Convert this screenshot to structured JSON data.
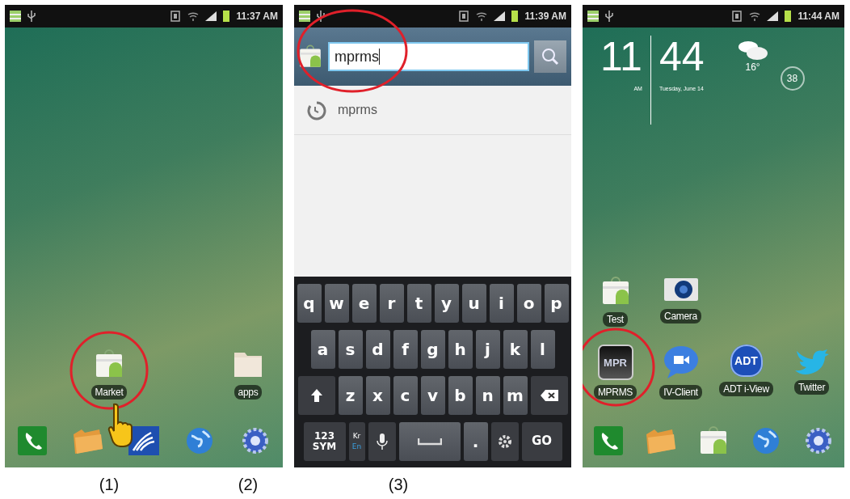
{
  "screens": [
    {
      "kind": "home",
      "status_bar": {
        "time": "11:37 AM"
      },
      "icon_rows": [
        [
          {
            "kind": "empty"
          },
          {
            "kind": "market",
            "label": "Market",
            "circled": true,
            "touched": true
          },
          {
            "kind": "empty"
          },
          {
            "kind": "folder",
            "label": "apps"
          }
        ]
      ],
      "dock": [
        {
          "kind": "phone"
        },
        {
          "kind": "files"
        },
        {
          "kind": "waves"
        },
        {
          "kind": "globe"
        },
        {
          "kind": "gear"
        }
      ]
    },
    {
      "kind": "search",
      "status_bar": {
        "time": "11:39 AM"
      },
      "search": {
        "value": "mprms",
        "circled": true
      },
      "suggestions": [
        {
          "text": "mprms"
        }
      ],
      "keyboard": [
        [
          {
            "kind": "char",
            "label": "q"
          },
          {
            "kind": "char",
            "label": "w"
          },
          {
            "kind": "char",
            "label": "e"
          },
          {
            "kind": "char",
            "label": "r"
          },
          {
            "kind": "char",
            "label": "t"
          },
          {
            "kind": "char",
            "label": "y"
          },
          {
            "kind": "char",
            "label": "u"
          },
          {
            "kind": "char",
            "label": "i"
          },
          {
            "kind": "char",
            "label": "o"
          },
          {
            "kind": "char",
            "label": "p"
          }
        ],
        [
          {
            "kind": "char",
            "label": "a"
          },
          {
            "kind": "char",
            "label": "s"
          },
          {
            "kind": "char",
            "label": "d"
          },
          {
            "kind": "char",
            "label": "f"
          },
          {
            "kind": "char",
            "label": "g"
          },
          {
            "kind": "char",
            "label": "h"
          },
          {
            "kind": "char",
            "label": "j"
          },
          {
            "kind": "char",
            "label": "k"
          },
          {
            "kind": "char",
            "label": "l"
          }
        ],
        [
          {
            "kind": "shift"
          },
          {
            "kind": "char",
            "label": "z"
          },
          {
            "kind": "char",
            "label": "x"
          },
          {
            "kind": "char",
            "label": "c"
          },
          {
            "kind": "char",
            "label": "v"
          },
          {
            "kind": "char",
            "label": "b"
          },
          {
            "kind": "char",
            "label": "n"
          },
          {
            "kind": "char",
            "label": "m"
          },
          {
            "kind": "backspace"
          }
        ],
        [
          {
            "kind": "sym",
            "label": "123\nSYM"
          },
          {
            "kind": "lang",
            "label": "Kr",
            "sub": "En"
          },
          {
            "kind": "mic"
          },
          {
            "kind": "space"
          },
          {
            "kind": "char",
            "label": "."
          },
          {
            "kind": "gear"
          },
          {
            "kind": "go",
            "label": "GO"
          }
        ]
      ]
    },
    {
      "kind": "home",
      "status_bar": {
        "time": "11:44 AM"
      },
      "widget": {
        "hour": "11",
        "minute": "44",
        "ampm": "AM",
        "date": "Tuesday, June 14",
        "temperature": "16°",
        "badge": "38"
      },
      "icon_rows": [
        [
          {
            "kind": "market",
            "label": "Test"
          },
          {
            "kind": "camera",
            "label": "Camera"
          }
        ],
        [
          {
            "kind": "mprms",
            "label": "MPRMS",
            "icon_text": "MPR",
            "circled": true
          },
          {
            "kind": "videochat",
            "label": "IV-Client"
          },
          {
            "kind": "adt",
            "label": "ADT i-View",
            "icon_text": "ADT"
          },
          {
            "kind": "bird",
            "label": "Twitter"
          }
        ]
      ],
      "dock": [
        {
          "kind": "phone"
        },
        {
          "kind": "files"
        },
        {
          "kind": "market"
        },
        {
          "kind": "globe"
        },
        {
          "kind": "gear"
        }
      ]
    }
  ],
  "captions": [
    {
      "text": "(1)"
    },
    {
      "text": "(2)"
    },
    {
      "text": "(3)"
    }
  ]
}
